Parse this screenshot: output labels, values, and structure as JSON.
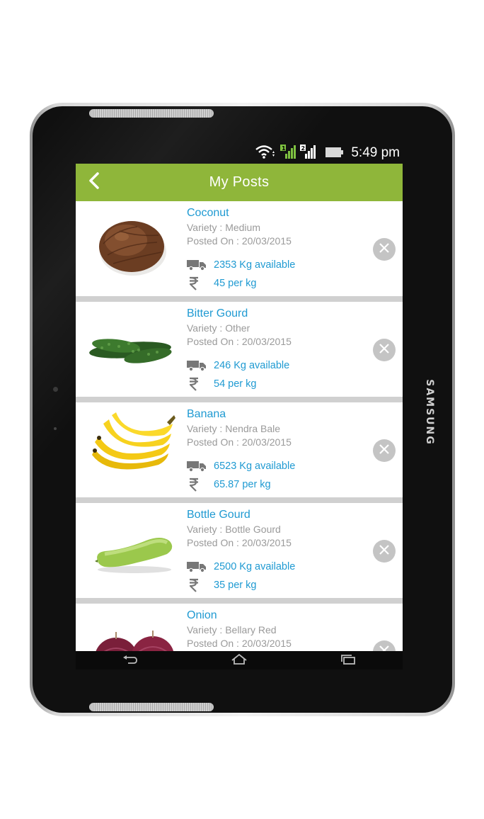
{
  "device": {
    "brand": "SAMSUNG"
  },
  "status_bar": {
    "time": "5:49 pm",
    "icons": [
      "wifi-icon",
      "sim1-signal-icon",
      "sim2-signal-icon",
      "battery-icon"
    ],
    "sim1_label": "1",
    "sim2_label": "2"
  },
  "app_bar": {
    "title": "My Posts",
    "back_icon": "chevron-left-icon",
    "color": "#8fb63a"
  },
  "posts": [
    {
      "name": "Coconut",
      "variety": "Variety : Medium",
      "posted": "Posted On : 20/03/2015",
      "available": "2353 Kg available",
      "price": "45 per kg",
      "image": "coconut"
    },
    {
      "name": "Bitter Gourd",
      "variety": "Variety : Other",
      "posted": "Posted On : 20/03/2015",
      "available": "246 Kg available",
      "price": "54 per kg",
      "image": "bitter-gourd"
    },
    {
      "name": "Banana",
      "variety": "Variety : Nendra Bale",
      "posted": "Posted On : 20/03/2015",
      "available": "6523 Kg available",
      "price": "65.87 per kg",
      "image": "banana"
    },
    {
      "name": "Bottle Gourd",
      "variety": "Variety : Bottle Gourd",
      "posted": "Posted On : 20/03/2015",
      "available": "2500 Kg available",
      "price": "35 per kg",
      "image": "bottle-gourd"
    },
    {
      "name": "Onion",
      "variety": "Variety : Bellary Red",
      "posted": "Posted On : 20/03/2015",
      "available": "",
      "price": "",
      "image": "onion"
    }
  ],
  "nav_bar": {
    "icons": [
      "back-nav-icon",
      "home-nav-icon",
      "recents-nav-icon"
    ]
  },
  "colors": {
    "accent_text": "#1f9ad2",
    "meta_text": "#9a9a9a",
    "remove_button": "#c4c4c4"
  }
}
